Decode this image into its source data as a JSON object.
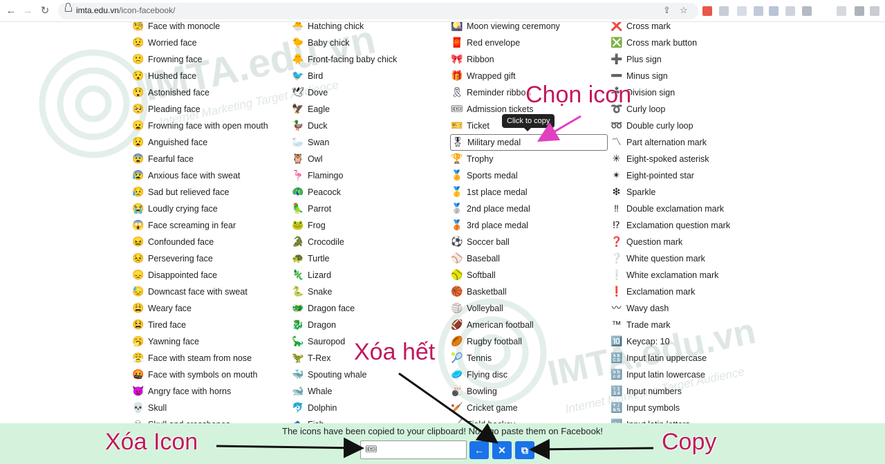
{
  "browser": {
    "url_domain": "imta.edu.vn",
    "url_path": "/icon-facebook/"
  },
  "columns": [
    [
      {
        "icon": "🧐",
        "label": "Face with monocle"
      },
      {
        "icon": "😟",
        "label": "Worried face"
      },
      {
        "icon": "🙁",
        "label": "Frowning face"
      },
      {
        "icon": "😯",
        "label": "Hushed face"
      },
      {
        "icon": "😲",
        "label": "Astonished face"
      },
      {
        "icon": "🥺",
        "label": "Pleading face"
      },
      {
        "icon": "😦",
        "label": "Frowning face with open mouth"
      },
      {
        "icon": "😧",
        "label": "Anguished face"
      },
      {
        "icon": "😨",
        "label": "Fearful face"
      },
      {
        "icon": "😰",
        "label": "Anxious face with sweat"
      },
      {
        "icon": "😥",
        "label": "Sad but relieved face"
      },
      {
        "icon": "😭",
        "label": "Loudly crying face"
      },
      {
        "icon": "😱",
        "label": "Face screaming in fear"
      },
      {
        "icon": "😖",
        "label": "Confounded face"
      },
      {
        "icon": "😣",
        "label": "Persevering face"
      },
      {
        "icon": "😞",
        "label": "Disappointed face"
      },
      {
        "icon": "😓",
        "label": "Downcast face with sweat"
      },
      {
        "icon": "😩",
        "label": "Weary face"
      },
      {
        "icon": "😫",
        "label": "Tired face"
      },
      {
        "icon": "🥱",
        "label": "Yawning face"
      },
      {
        "icon": "😤",
        "label": "Face with steam from nose"
      },
      {
        "icon": "🤬",
        "label": "Face with symbols on mouth"
      },
      {
        "icon": "👿",
        "label": "Angry face with horns"
      },
      {
        "icon": "💀",
        "label": "Skull"
      },
      {
        "icon": "☠",
        "label": "Skull and crossbones"
      }
    ],
    [
      {
        "icon": "🐣",
        "label": "Hatching chick"
      },
      {
        "icon": "🐤",
        "label": "Baby chick"
      },
      {
        "icon": "🐥",
        "label": "Front-facing baby chick"
      },
      {
        "icon": "🐦",
        "label": "Bird"
      },
      {
        "icon": "🕊",
        "label": "Dove"
      },
      {
        "icon": "🦅",
        "label": "Eagle"
      },
      {
        "icon": "🦆",
        "label": "Duck"
      },
      {
        "icon": "🦢",
        "label": "Swan"
      },
      {
        "icon": "🦉",
        "label": "Owl"
      },
      {
        "icon": "🦩",
        "label": "Flamingo"
      },
      {
        "icon": "🦚",
        "label": "Peacock"
      },
      {
        "icon": "🦜",
        "label": "Parrot"
      },
      {
        "icon": "🐸",
        "label": "Frog"
      },
      {
        "icon": "🐊",
        "label": "Crocodile"
      },
      {
        "icon": "🐢",
        "label": "Turtle"
      },
      {
        "icon": "🦎",
        "label": "Lizard"
      },
      {
        "icon": "🐍",
        "label": "Snake"
      },
      {
        "icon": "🐲",
        "label": "Dragon face"
      },
      {
        "icon": "🐉",
        "label": "Dragon"
      },
      {
        "icon": "🦕",
        "label": "Sauropod"
      },
      {
        "icon": "🦖",
        "label": "T-Rex"
      },
      {
        "icon": "🐳",
        "label": "Spouting whale"
      },
      {
        "icon": "🐋",
        "label": "Whale"
      },
      {
        "icon": "🐬",
        "label": "Dolphin"
      },
      {
        "icon": "🐟",
        "label": "Fish"
      }
    ],
    [
      {
        "icon": "🎑",
        "label": "Moon viewing ceremony"
      },
      {
        "icon": "🧧",
        "label": "Red envelope"
      },
      {
        "icon": "🎀",
        "label": "Ribbon"
      },
      {
        "icon": "🎁",
        "label": "Wrapped gift"
      },
      {
        "icon": "🎗",
        "label": "Reminder ribbon"
      },
      {
        "icon": "🎟",
        "label": "Admission tickets"
      },
      {
        "icon": "🎫",
        "label": "Ticket"
      },
      {
        "icon": "🎖",
        "label": "Military medal"
      },
      {
        "icon": "🏆",
        "label": "Trophy"
      },
      {
        "icon": "🏅",
        "label": "Sports medal"
      },
      {
        "icon": "🥇",
        "label": "1st place medal"
      },
      {
        "icon": "🥈",
        "label": "2nd place medal"
      },
      {
        "icon": "🥉",
        "label": "3rd place medal"
      },
      {
        "icon": "⚽",
        "label": "Soccer ball"
      },
      {
        "icon": "⚾",
        "label": "Baseball"
      },
      {
        "icon": "🥎",
        "label": "Softball"
      },
      {
        "icon": "🏀",
        "label": "Basketball"
      },
      {
        "icon": "🏐",
        "label": "Volleyball"
      },
      {
        "icon": "🏈",
        "label": "American football"
      },
      {
        "icon": "🏉",
        "label": "Rugby football"
      },
      {
        "icon": "🎾",
        "label": "Tennis"
      },
      {
        "icon": "🥏",
        "label": "Flying disc"
      },
      {
        "icon": "🎳",
        "label": "Bowling"
      },
      {
        "icon": "🏏",
        "label": "Cricket game"
      },
      {
        "icon": "🏑",
        "label": "Field hockey"
      }
    ],
    [
      {
        "icon": "❌",
        "label": "Cross mark"
      },
      {
        "icon": "❎",
        "label": "Cross mark button"
      },
      {
        "icon": "➕",
        "label": "Plus sign"
      },
      {
        "icon": "➖",
        "label": "Minus sign"
      },
      {
        "icon": "➗",
        "label": "Division sign"
      },
      {
        "icon": "➰",
        "label": "Curly loop"
      },
      {
        "icon": "➿",
        "label": "Double curly loop"
      },
      {
        "icon": "〽",
        "label": "Part alternation mark"
      },
      {
        "icon": "✳",
        "label": "Eight-spoked asterisk"
      },
      {
        "icon": "✴",
        "label": "Eight-pointed star"
      },
      {
        "icon": "❇",
        "label": "Sparkle"
      },
      {
        "icon": "‼",
        "label": "Double exclamation mark"
      },
      {
        "icon": "⁉",
        "label": "Exclamation question mark"
      },
      {
        "icon": "❓",
        "label": "Question mark"
      },
      {
        "icon": "❔",
        "label": "White question mark"
      },
      {
        "icon": "❕",
        "label": "White exclamation mark"
      },
      {
        "icon": "❗",
        "label": "Exclamation mark"
      },
      {
        "icon": "〰",
        "label": "Wavy dash"
      },
      {
        "icon": "™",
        "label": "Trade mark"
      },
      {
        "icon": "🔟",
        "label": "Keycap: 10"
      },
      {
        "icon": "🔠",
        "label": "Input latin uppercase"
      },
      {
        "icon": "🔡",
        "label": "Input latin lowercase"
      },
      {
        "icon": "🔢",
        "label": "Input numbers"
      },
      {
        "icon": "🔣",
        "label": "Input symbols"
      },
      {
        "icon": "🔤",
        "label": "Input latin letters"
      }
    ]
  ],
  "tooltip": "Click to copy",
  "footer": {
    "message": "The icons have been copied to your clipboard! Now go paste them on Facebook!",
    "field_value": "🎟",
    "backspace_icon": "←",
    "clear_icon": "✕",
    "copy_icon": "⧉"
  },
  "annotations": {
    "choose_icon": "Chọn icon",
    "clear_all": "Xóa hết",
    "delete_icon": "Xóa Icon",
    "copy": "Copy"
  },
  "watermark": {
    "brand": "IMTA.edu.vn",
    "tagline": "Internet Marketing Target Audience"
  },
  "colors": {
    "annotation": "#c2185b",
    "footer_bg": "#d4f3dd",
    "button": "#1a73e8"
  }
}
